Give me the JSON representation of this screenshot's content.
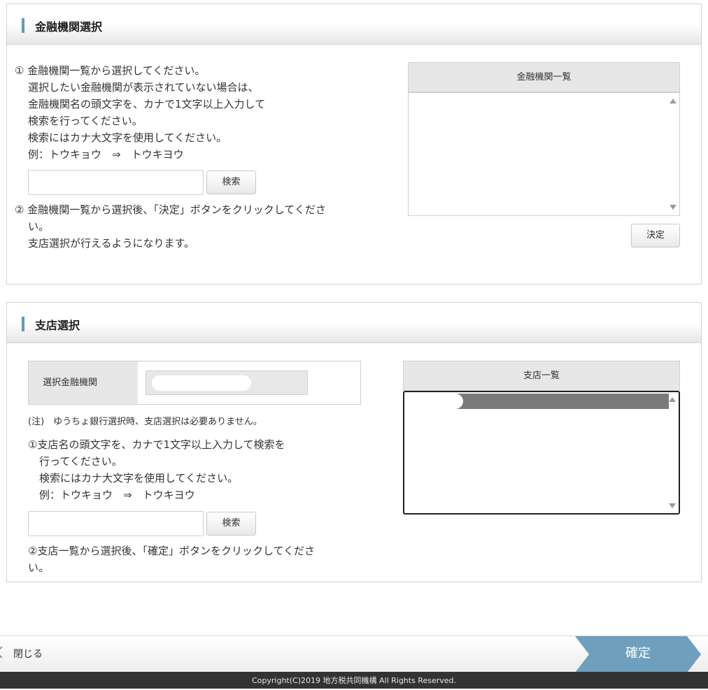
{
  "bank_section": {
    "title": "金融機関選択",
    "instructions": [
      "① 金融機関一覧から選択してください。",
      "選択したい金融機関が表示されていない場合は、",
      "金融機関名の頭文字を、カナで1文字以上入力して",
      "検索を行ってください。",
      "検索にはカナ大文字を使用してください。",
      "例：トウキョウ　⇒　トウキヨウ"
    ],
    "search_value": "",
    "search_button": "検索",
    "step2": [
      "② 金融機関一覧から選択後、「決定」ボタンをクリックしてくださ",
      "い。",
      "支店選択が行えるようになります。"
    ],
    "list_header": "金融機関一覧",
    "decide_button": "決定"
  },
  "branch_section": {
    "title": "支店選択",
    "selected_bank_label": "選択金融機関",
    "note": "(注)　ゆうちょ銀行選択時、支店選択は必要ありません。",
    "instructions": [
      "①支店名の頭文字を、カナで1文字以上入力して検索を",
      "行ってください。",
      "検索にはカナ大文字を使用してください。",
      "例：トウキョウ　⇒　トウキヨウ"
    ],
    "search_value": "",
    "search_button": "検索",
    "step2": [
      "②支店一覧から選択後、「確定」ボタンをクリックしてくださ",
      "い。"
    ],
    "list_header": "支店一覧"
  },
  "footer": {
    "close_label": "閉じる",
    "confirm_label": "確定",
    "copyright": "Copyright(C)2019 地方税共同機構 All Rights Reserved."
  },
  "colors": {
    "accent": "#5f9cb8",
    "confirm_button": "#6e9fbd",
    "footer_bg": "#333333"
  }
}
